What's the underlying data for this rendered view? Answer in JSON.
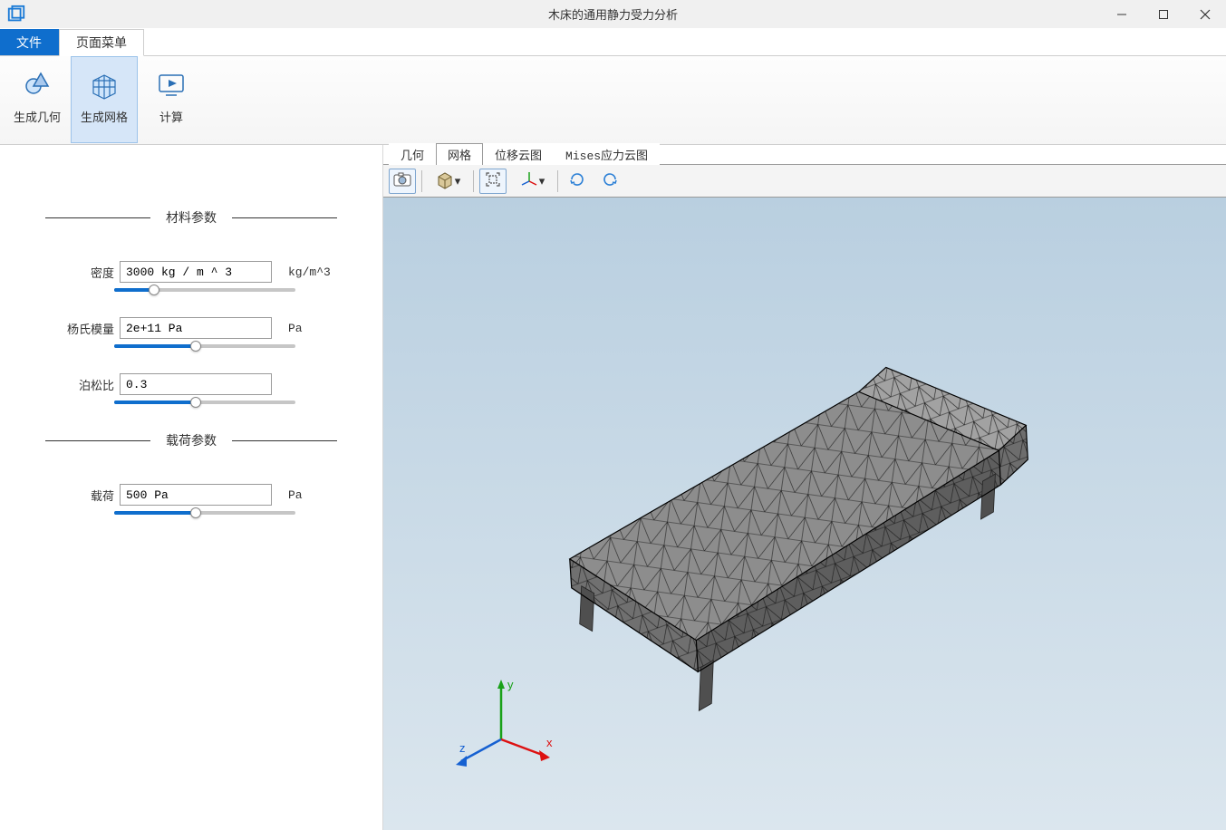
{
  "window": {
    "title": "木床的通用静力受力分析"
  },
  "menu": {
    "file": "文件",
    "pageMenu": "页面菜单"
  },
  "ribbon": {
    "genGeom": "生成几何",
    "genMesh": "生成网格",
    "compute": "计算"
  },
  "viewTabs": {
    "geom": "几何",
    "mesh": "网格",
    "disp": "位移云图",
    "mises": "Mises应力云图"
  },
  "materialGroup": {
    "heading": "材料参数",
    "density": {
      "label": "密度",
      "value": "3000 kg / m ^ 3",
      "unit": "kg/m^3",
      "pos": 22
    },
    "young": {
      "label": "杨氏模量",
      "value": "2e+11 Pa",
      "unit": "Pa",
      "pos": 45
    },
    "poisson": {
      "label": "泊松比",
      "value": "0.3",
      "unit": "",
      "pos": 45
    }
  },
  "loadGroup": {
    "heading": "载荷参数",
    "load": {
      "label": "载荷",
      "value": "500 Pa",
      "unit": "Pa",
      "pos": 45
    }
  },
  "triad": {
    "x": "x",
    "y": "y",
    "z": "z"
  }
}
